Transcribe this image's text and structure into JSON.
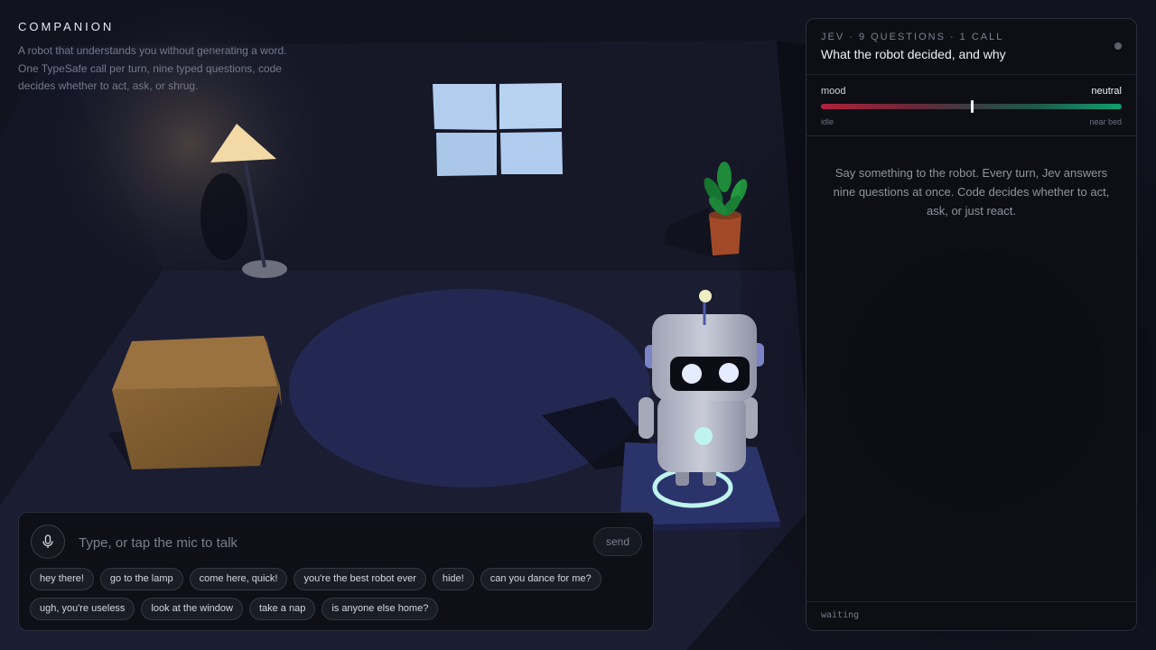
{
  "brand": {
    "title": "COMPANION",
    "description_lines": [
      "A robot that understands you without generating a word.",
      "One TypeSafe call per turn, nine typed questions, code",
      "decides whether to act, ask, or shrug."
    ]
  },
  "panel": {
    "kicker": "JEV · 9 QUESTIONS · 1 CALL",
    "title": "What the robot decided, and why",
    "mood": {
      "label": "mood",
      "value_label": "neutral",
      "value": 0.5,
      "left_label": "idle",
      "right_label": "near bed"
    },
    "message": "Say something to the robot. Every turn, Jev answers nine questions at once. Code decides whether to act, ask, or just react.",
    "status": "waiting"
  },
  "composer": {
    "placeholder": "Type, or tap the mic to talk",
    "send_label": "send",
    "chips_row1": [
      "hey there!",
      "go to the lamp",
      "come here, quick!",
      "you're the best robot ever",
      "hide!",
      "can you dance for me?"
    ],
    "chips_row2": [
      "ugh, you're useless",
      "look at the window",
      "take a nap",
      "is anyone else home?"
    ]
  },
  "scene": {
    "icons": [
      "lamp",
      "window",
      "plant",
      "box",
      "robot",
      "rug"
    ]
  },
  "colors": {
    "background": "#11131f",
    "mood_negative": "#b0223f",
    "mood_positive": "#0fa070",
    "robot_eye": "#e6ecff",
    "robot_ring": "#bff3ee"
  }
}
